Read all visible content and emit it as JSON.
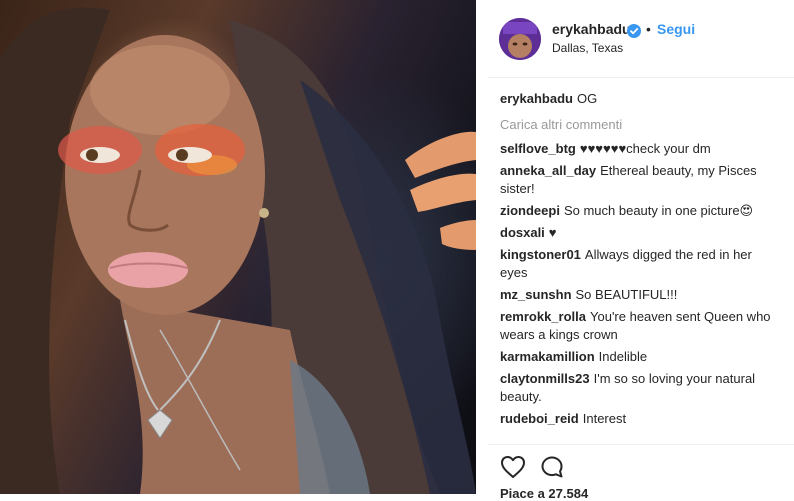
{
  "post": {
    "username": "erykahbadu",
    "dot": "•",
    "follow_label": "Segui",
    "location": "Dallas, Texas"
  },
  "caption": {
    "user": "erykahbadu",
    "text": "OG"
  },
  "load_more_label": "Carica altri commenti",
  "comments": [
    {
      "user": "selflove_btg",
      "text": "♥♥♥♥♥♥check your dm"
    },
    {
      "user": "anneka_all_day",
      "text": "Ethereal beauty, my Pisces sister!"
    },
    {
      "user": "ziondeepi",
      "text": "So much beauty in one picture😍"
    },
    {
      "user": "dosxali",
      "text": "♥"
    },
    {
      "user": "kingstoner01",
      "text": "Allways digged the red in her eyes"
    },
    {
      "user": "mz_sunshn",
      "text": "So BEAUTIFUL!!!"
    },
    {
      "user": "remrokk_rolla",
      "text": "You're heaven sent Queen who wears a kings crown"
    },
    {
      "user": "karmakamillion",
      "text": "Indelible"
    },
    {
      "user": "claytonmills23",
      "text": "I'm so so loving your natural beauty."
    },
    {
      "user": "rudeboi_reid",
      "text": "Interest"
    }
  ],
  "likes_text": "Piace a 27.584",
  "icons": {
    "verified": "verified-badge-icon",
    "like": "heart-icon",
    "comment": "comment-bubble-icon"
  },
  "colors": {
    "link_blue": "#3897f0",
    "verified_blue": "#3897f0",
    "muted_text": "#999999",
    "divider": "#efefef"
  }
}
